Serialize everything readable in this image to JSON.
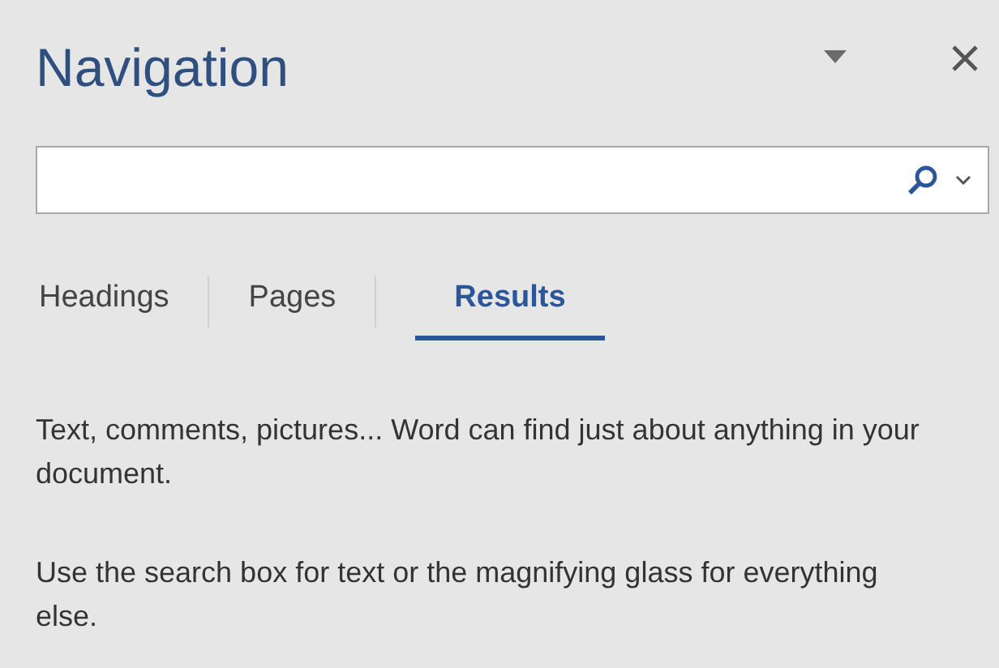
{
  "pane": {
    "title": "Navigation"
  },
  "tabs": [
    {
      "label": "Headings",
      "selected": false
    },
    {
      "label": "Pages",
      "selected": false
    },
    {
      "label": "Results",
      "selected": true
    }
  ],
  "paragraphs": [
    "Text, comments, pictures... Word can find just about anything in your document.",
    "Use the search box for text or the magnifying glass for everything else."
  ]
}
